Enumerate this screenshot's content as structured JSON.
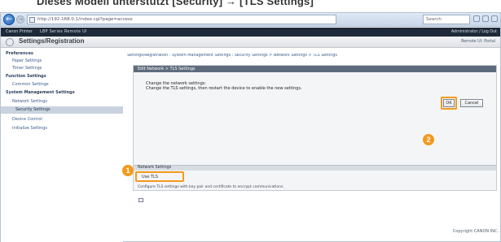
{
  "caption": "Dieses Modell unterstützt [Security] → [TLS Settings]",
  "browser": {
    "url": "http://192.168.0.1/index.cgi?page=access",
    "search_placeholder": "Search",
    "back_icon": "back-arrow-icon",
    "forward_icon": "forward-arrow-icon"
  },
  "device_header": {
    "left": "Canon Printer",
    "model": "LBP Series Remote UI",
    "right": "Administrator / Log Out"
  },
  "app": {
    "title": "Settings/Registration",
    "title_right": "Remote UI: Portal"
  },
  "sidebar": {
    "items": [
      {
        "label": "Preferences",
        "type": "sec"
      },
      {
        "label": "Paper Settings",
        "type": "sub"
      },
      {
        "label": "Timer Settings",
        "type": "sub"
      },
      {
        "label": "Function Settings",
        "type": "sec"
      },
      {
        "label": "Common Settings",
        "type": "sub"
      },
      {
        "label": "System Management Settings",
        "type": "sec"
      },
      {
        "label": "Network Settings",
        "type": "sub"
      },
      {
        "label": "Security Settings",
        "type": "active"
      },
      {
        "label": "Device Control",
        "type": "sub"
      },
      {
        "label": "Initialize Settings",
        "type": "sub"
      }
    ]
  },
  "content": {
    "breadcrumb": "Settings/Registration : System Management Settings : Security Settings > Network Settings > TLS Settings",
    "panel_title": "Edit Network > TLS Settings",
    "message_line1": "Change the network settings:",
    "message_line2": "Change the TLS settings, then restart the device to enable the new settings.",
    "message_line3": "",
    "ok_label": "OK",
    "cancel_label": "Cancel",
    "section_title": "Network Settings",
    "checkbox_label": "Use TLS",
    "note": "Configure TLS settings with key pair and certificate to encrypt communications.",
    "copyright": "Copyright CANON INC."
  },
  "callouts": {
    "one": "1",
    "two": "2"
  },
  "colors": {
    "accent": "#f39a1e",
    "header": "#1e2a39",
    "panel_head": "#5e6b7c"
  }
}
